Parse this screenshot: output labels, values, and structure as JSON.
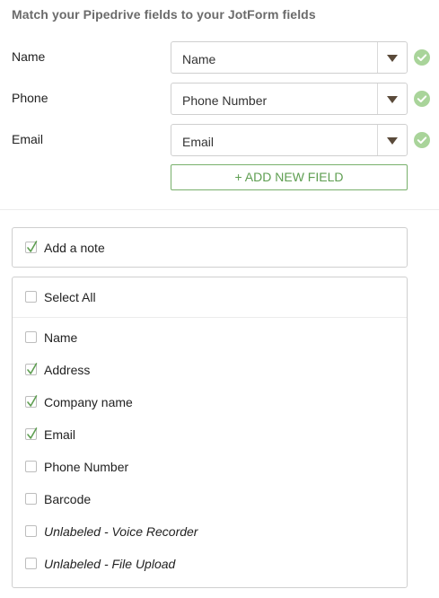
{
  "header": {
    "title": "Match your Pipedrive fields to your JotForm fields"
  },
  "mappings": [
    {
      "label": "Name",
      "selected": "Name"
    },
    {
      "label": "Phone",
      "selected": "Phone Number"
    },
    {
      "label": "Email",
      "selected": "Email"
    }
  ],
  "add_field_label": "+ ADD NEW FIELD",
  "note": {
    "label": "Add a note",
    "checked": true
  },
  "select_all": {
    "label": "Select All",
    "checked": false
  },
  "fields": [
    {
      "label": "Name",
      "checked": false,
      "italic": false
    },
    {
      "label": "Address",
      "checked": true,
      "italic": false
    },
    {
      "label": "Company name",
      "checked": true,
      "italic": false
    },
    {
      "label": "Email",
      "checked": true,
      "italic": false
    },
    {
      "label": "Phone Number",
      "checked": false,
      "italic": false
    },
    {
      "label": "Barcode",
      "checked": false,
      "italic": false
    },
    {
      "label": "Unlabeled - Voice Recorder",
      "checked": false,
      "italic": true
    },
    {
      "label": "Unlabeled - File Upload",
      "checked": false,
      "italic": true
    }
  ],
  "colors": {
    "accent_green": "#5e9e51",
    "ok_green": "#a9d49a",
    "border": "#cfcfcf"
  }
}
